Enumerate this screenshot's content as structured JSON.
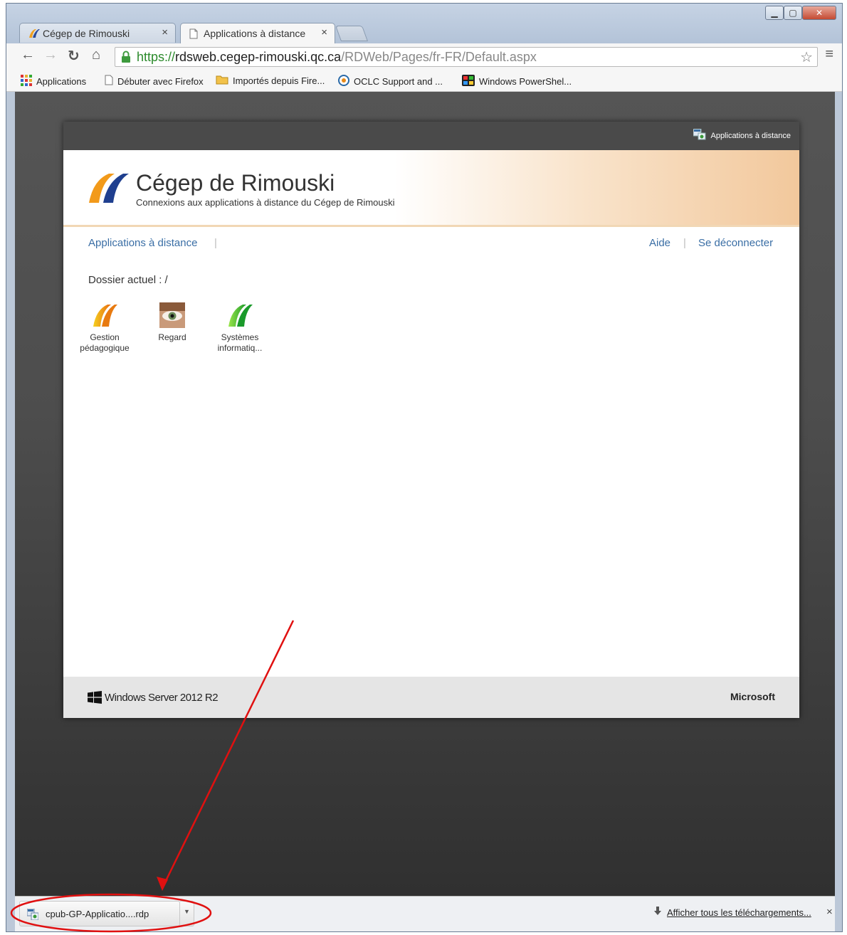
{
  "browser": {
    "tabs": [
      {
        "label": "Cégep de Rimouski",
        "icon": "cegep-logo-icon",
        "active": false
      },
      {
        "label": "Applications à distance",
        "icon": "page-icon",
        "active": true
      }
    ],
    "tab_close": "×",
    "url": {
      "scheme": "https://",
      "host": "rdsweb.cegep-rimouski.qc.ca",
      "path": "/RDWeb/Pages/fr-FR/Default.aspx"
    },
    "bookmarks": [
      {
        "label": "Applications",
        "icon": "apps-grid-icon"
      },
      {
        "label": "Débuter avec Firefox",
        "icon": "page-icon"
      },
      {
        "label": "Importés depuis Fire...",
        "icon": "folder-icon"
      },
      {
        "label": "OCLC Support and ...",
        "icon": "oclc-icon"
      },
      {
        "label": "Windows PowerShel...",
        "icon": "powershell-icon"
      }
    ]
  },
  "rdweb": {
    "top_link": "Applications à distance",
    "title": "Cégep de Rimouski",
    "subtitle": "Connexions aux applications à distance du Cégep de Rimouski",
    "nav": {
      "remote_apps": "Applications à distance",
      "separator": "|",
      "help": "Aide",
      "logout": "Se déconnecter"
    },
    "current_folder": "Dossier actuel : /",
    "apps": [
      {
        "line1": "Gestion",
        "line2": "pédagogique",
        "icon": "gestion-app-icon"
      },
      {
        "line1": "Regard",
        "line2": "",
        "icon": "regard-eye-icon"
      },
      {
        "line1": "Systèmes",
        "line2": "informatiq...",
        "icon": "systemes-app-icon"
      }
    ],
    "footer_left": "Windows Server 2012 R2",
    "footer_right": "Microsoft"
  },
  "downloads": {
    "file": "cpub-GP-Applicatio....rdp",
    "show_all": "Afficher tous les téléchargements...",
    "close": "×"
  },
  "annotation": {
    "arrow_color": "#e01010",
    "ellipse_color": "#e01010"
  }
}
